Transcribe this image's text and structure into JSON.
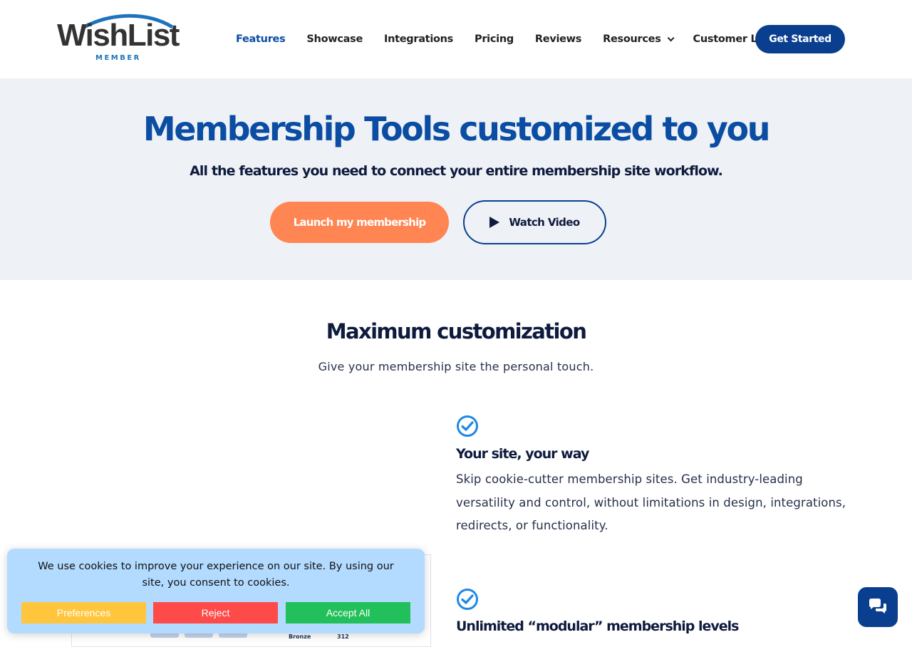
{
  "header": {
    "logo_text": "WishList",
    "logo_sub": "MEMBER",
    "nav": [
      {
        "label": "Features",
        "active": true
      },
      {
        "label": "Showcase"
      },
      {
        "label": "Integrations"
      },
      {
        "label": "Pricing"
      },
      {
        "label": "Reviews"
      },
      {
        "label": "Resources",
        "has_dropdown": true
      },
      {
        "label": "Customer Login"
      }
    ],
    "cta": "Get Started"
  },
  "hero": {
    "title": "Membership Tools customized to you",
    "subtitle": "All the features you need to connect your entire membership site workflow.",
    "launch_button": "Launch my membership",
    "video_button": "Watch Video"
  },
  "section": {
    "title": "Maximum customization",
    "subtitle": "Give your membership site the personal touch.",
    "features": [
      {
        "title": "Your site, your way",
        "text": "Skip cookie-cutter membership sites. Get industry-leading versatility and control, without limitations in design, integrations, redirects, or functionality."
      },
      {
        "title": "Unlimited “modular” membership levels",
        "text": ""
      }
    ],
    "preview_labels": [
      "Bronze",
      "312"
    ]
  },
  "cookie": {
    "text": "We use cookies to improve your experience on our site. By using our site, you consent to cookies.",
    "preferences": "Preferences",
    "reject": "Reject",
    "accept": "Accept All"
  },
  "colors": {
    "brand_blue": "#0a4da2",
    "navy": "#0a3f8f",
    "orange": "#ff8552",
    "hero_bg": "#eef2f7",
    "check_blue": "#1e88e5"
  },
  "icons": {
    "check": "check-circle-icon",
    "play": "play-icon",
    "chat": "chat-bubbles-icon",
    "dropdown": "chevron-down-icon"
  }
}
